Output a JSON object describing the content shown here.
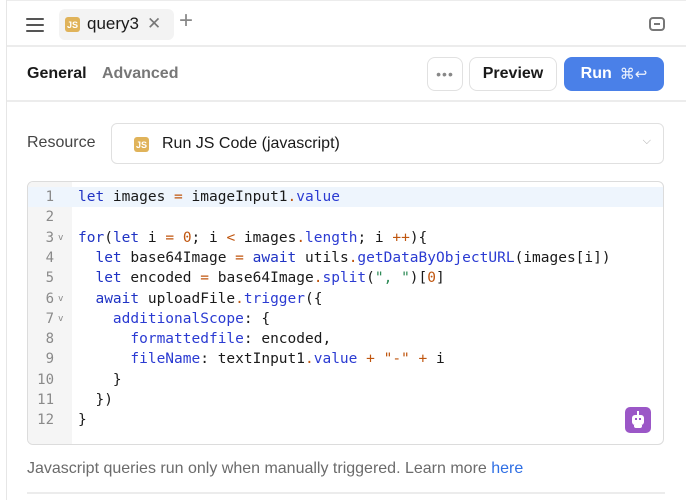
{
  "topbar": {
    "menu_icon": "hamburger-icon",
    "tab": {
      "badge": "JS",
      "label": "query3",
      "close_glyph": "✕"
    },
    "add_tab_glyph": "+",
    "collapse_icon": "collapse-panel-icon"
  },
  "toolbar": {
    "tabs": [
      {
        "label": "General",
        "active": true
      },
      {
        "label": "Advanced",
        "active": false
      }
    ],
    "more_label": "•••",
    "preview_label": "Preview",
    "run_label": "Run",
    "run_shortcut": "⌘↩",
    "run_color": "#4a80e8"
  },
  "resource": {
    "label": "Resource",
    "badge": "JS",
    "value": "Run JS Code (javascript)",
    "chevron": "⌄"
  },
  "editor": {
    "lines": [
      {
        "n": "1",
        "fold": "",
        "html": "<span class=\"kw\">let</span> images <span class=\"op\">=</span> imageInput1<span class=\"op\">.</span><span class=\"prop\">value</span>"
      },
      {
        "n": "2",
        "fold": "",
        "html": ""
      },
      {
        "n": "3",
        "fold": "⌄",
        "html": "<span class=\"kw\">for</span>(<span class=\"kw\">let</span> i <span class=\"op\">=</span> <span class=\"num\">0</span>; i <span class=\"op\">&lt;</span> images<span class=\"op\">.</span><span class=\"prop\">length</span>; i <span class=\"op\">++</span>){"
      },
      {
        "n": "4",
        "fold": "",
        "html": "  <span class=\"kw\">let</span> base64Image <span class=\"op\">=</span> <span class=\"kw\">await</span> utils<span class=\"op\">.</span><span class=\"prop\">getDataByObjectURL</span>(images[i])"
      },
      {
        "n": "5",
        "fold": "",
        "html": "  <span class=\"kw\">let</span> encoded <span class=\"op\">=</span> base64Image<span class=\"op\">.</span><span class=\"prop\">split</span>(<span class=\"str\">\", \"</span>)[<span class=\"num\">0</span>]"
      },
      {
        "n": "6",
        "fold": "⌄",
        "html": "  <span class=\"kw\">await</span> uploadFile<span class=\"op\">.</span><span class=\"prop\">trigger</span>({"
      },
      {
        "n": "7",
        "fold": "⌄",
        "html": "    <span class=\"prop\">additionalScope</span>: {"
      },
      {
        "n": "8",
        "fold": "",
        "html": "      <span class=\"prop\">formattedfile</span>: encoded,"
      },
      {
        "n": "9",
        "fold": "",
        "html": "      <span class=\"prop\">fileName</span>: textInput1<span class=\"op\">.</span><span class=\"prop\">value</span> <span class=\"op\">+</span> <span class=\"op\">\"-\"</span> <span class=\"op\">+</span> i"
      },
      {
        "n": "10",
        "fold": "",
        "html": "    }"
      },
      {
        "n": "11",
        "fold": "",
        "html": "  })"
      },
      {
        "n": "12",
        "fold": "",
        "html": "}"
      }
    ],
    "active_line": 1,
    "ai_icon": "ai-assistant-robot-icon"
  },
  "footer": {
    "note": "Javascript queries run only when manually triggered. Learn more ",
    "link_label": "here"
  }
}
